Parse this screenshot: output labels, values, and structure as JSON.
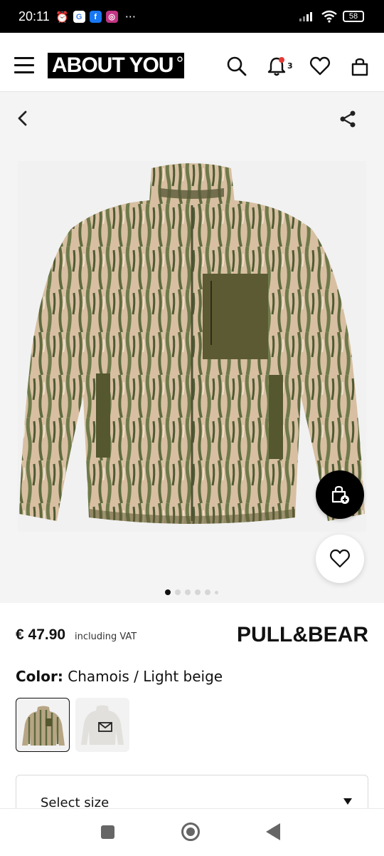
{
  "status_bar": {
    "time": "20:11",
    "apps": [
      "G",
      "f",
      "◎"
    ],
    "more": "···",
    "battery": "58"
  },
  "header": {
    "logo_text": "ABOUT YOU",
    "notification_count": "3",
    "icons": [
      "menu-icon",
      "search-icon",
      "bell-icon",
      "heart-icon",
      "bag-icon"
    ]
  },
  "gallery": {
    "image_count": 6,
    "active_index": 0
  },
  "product": {
    "price": "€ 47.90",
    "vat_note": "including VAT",
    "brand": "PULL&BEAR",
    "color_label": "Color:",
    "color_value": "Chamois / Light beige",
    "size_select_label": "Select size"
  },
  "colors": {
    "accent": "#000000",
    "notification_dot": "#e53935",
    "jacket_beige": "#d8bfa2",
    "jacket_green": "#5e6a3d",
    "gallery_bg": "#f4f4f4"
  }
}
